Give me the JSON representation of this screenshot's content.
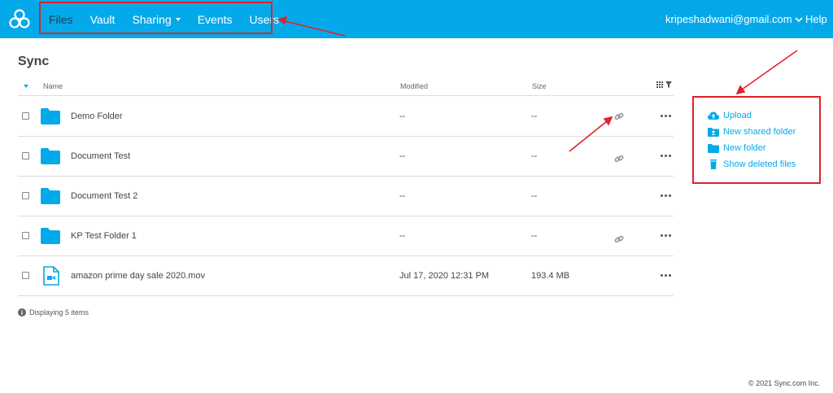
{
  "nav": {
    "items": [
      {
        "label": "Files",
        "active": true
      },
      {
        "label": "Vault"
      },
      {
        "label": "Sharing",
        "dropdown": true
      },
      {
        "label": "Events"
      },
      {
        "label": "Users"
      }
    ],
    "account": "kripeshadwani@gmail.com",
    "help": "Help"
  },
  "page": {
    "title": "Sync"
  },
  "table": {
    "columns": {
      "name": "Name",
      "modified": "Modified",
      "size": "Size"
    },
    "rows": [
      {
        "name": "Demo Folder",
        "modified": "--",
        "size": "--",
        "type": "folder",
        "has_link": true
      },
      {
        "name": "Document Test",
        "modified": "--",
        "size": "--",
        "type": "folder",
        "has_link": true
      },
      {
        "name": "Document Test 2",
        "modified": "--",
        "size": "--",
        "type": "folder",
        "has_link": false
      },
      {
        "name": "KP Test Folder 1",
        "modified": "--",
        "size": "--",
        "type": "folder",
        "has_link": true
      },
      {
        "name": "amazon prime day sale 2020.mov",
        "modified": "Jul 17, 2020 12:31 PM",
        "size": "193.4 MB",
        "type": "video",
        "has_link": false
      }
    ],
    "footer": "Displaying 5 items"
  },
  "actions": [
    {
      "label": "Upload",
      "icon": "cloud-upload-icon"
    },
    {
      "label": "New shared folder",
      "icon": "shared-folder-icon"
    },
    {
      "label": "New folder",
      "icon": "folder-icon"
    },
    {
      "label": "Show deleted files",
      "icon": "trash-icon"
    }
  ],
  "copyright": "© 2021 Sync.com Inc.",
  "colors": {
    "brand": "#04a9ea",
    "nav_active": "#1d3e57",
    "annotation": "#e0222a"
  }
}
